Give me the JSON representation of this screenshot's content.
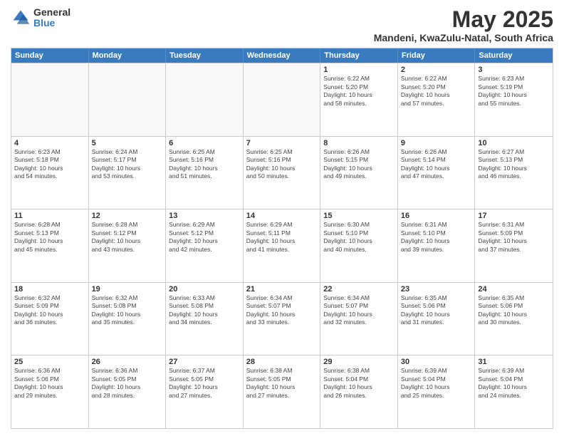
{
  "logo": {
    "general": "General",
    "blue": "Blue"
  },
  "title": {
    "month": "May 2025",
    "location": "Mandeni, KwaZulu-Natal, South Africa"
  },
  "calendar": {
    "headers": [
      "Sunday",
      "Monday",
      "Tuesday",
      "Wednesday",
      "Thursday",
      "Friday",
      "Saturday"
    ],
    "weeks": [
      [
        {
          "day": "",
          "detail": ""
        },
        {
          "day": "",
          "detail": ""
        },
        {
          "day": "",
          "detail": ""
        },
        {
          "day": "",
          "detail": ""
        },
        {
          "day": "1",
          "detail": "Sunrise: 6:22 AM\nSunset: 5:20 PM\nDaylight: 10 hours\nand 58 minutes."
        },
        {
          "day": "2",
          "detail": "Sunrise: 6:22 AM\nSunset: 5:20 PM\nDaylight: 10 hours\nand 57 minutes."
        },
        {
          "day": "3",
          "detail": "Sunrise: 6:23 AM\nSunset: 5:19 PM\nDaylight: 10 hours\nand 55 minutes."
        }
      ],
      [
        {
          "day": "4",
          "detail": "Sunrise: 6:23 AM\nSunset: 5:18 PM\nDaylight: 10 hours\nand 54 minutes."
        },
        {
          "day": "5",
          "detail": "Sunrise: 6:24 AM\nSunset: 5:17 PM\nDaylight: 10 hours\nand 53 minutes."
        },
        {
          "day": "6",
          "detail": "Sunrise: 6:25 AM\nSunset: 5:16 PM\nDaylight: 10 hours\nand 51 minutes."
        },
        {
          "day": "7",
          "detail": "Sunrise: 6:25 AM\nSunset: 5:16 PM\nDaylight: 10 hours\nand 50 minutes."
        },
        {
          "day": "8",
          "detail": "Sunrise: 6:26 AM\nSunset: 5:15 PM\nDaylight: 10 hours\nand 49 minutes."
        },
        {
          "day": "9",
          "detail": "Sunrise: 6:26 AM\nSunset: 5:14 PM\nDaylight: 10 hours\nand 47 minutes."
        },
        {
          "day": "10",
          "detail": "Sunrise: 6:27 AM\nSunset: 5:13 PM\nDaylight: 10 hours\nand 46 minutes."
        }
      ],
      [
        {
          "day": "11",
          "detail": "Sunrise: 6:28 AM\nSunset: 5:13 PM\nDaylight: 10 hours\nand 45 minutes."
        },
        {
          "day": "12",
          "detail": "Sunrise: 6:28 AM\nSunset: 5:12 PM\nDaylight: 10 hours\nand 43 minutes."
        },
        {
          "day": "13",
          "detail": "Sunrise: 6:29 AM\nSunset: 5:12 PM\nDaylight: 10 hours\nand 42 minutes."
        },
        {
          "day": "14",
          "detail": "Sunrise: 6:29 AM\nSunset: 5:11 PM\nDaylight: 10 hours\nand 41 minutes."
        },
        {
          "day": "15",
          "detail": "Sunrise: 6:30 AM\nSunset: 5:10 PM\nDaylight: 10 hours\nand 40 minutes."
        },
        {
          "day": "16",
          "detail": "Sunrise: 6:31 AM\nSunset: 5:10 PM\nDaylight: 10 hours\nand 39 minutes."
        },
        {
          "day": "17",
          "detail": "Sunrise: 6:31 AM\nSunset: 5:09 PM\nDaylight: 10 hours\nand 37 minutes."
        }
      ],
      [
        {
          "day": "18",
          "detail": "Sunrise: 6:32 AM\nSunset: 5:09 PM\nDaylight: 10 hours\nand 36 minutes."
        },
        {
          "day": "19",
          "detail": "Sunrise: 6:32 AM\nSunset: 5:08 PM\nDaylight: 10 hours\nand 35 minutes."
        },
        {
          "day": "20",
          "detail": "Sunrise: 6:33 AM\nSunset: 5:08 PM\nDaylight: 10 hours\nand 34 minutes."
        },
        {
          "day": "21",
          "detail": "Sunrise: 6:34 AM\nSunset: 5:07 PM\nDaylight: 10 hours\nand 33 minutes."
        },
        {
          "day": "22",
          "detail": "Sunrise: 6:34 AM\nSunset: 5:07 PM\nDaylight: 10 hours\nand 32 minutes."
        },
        {
          "day": "23",
          "detail": "Sunrise: 6:35 AM\nSunset: 5:06 PM\nDaylight: 10 hours\nand 31 minutes."
        },
        {
          "day": "24",
          "detail": "Sunrise: 6:35 AM\nSunset: 5:06 PM\nDaylight: 10 hours\nand 30 minutes."
        }
      ],
      [
        {
          "day": "25",
          "detail": "Sunrise: 6:36 AM\nSunset: 5:06 PM\nDaylight: 10 hours\nand 29 minutes."
        },
        {
          "day": "26",
          "detail": "Sunrise: 6:36 AM\nSunset: 5:05 PM\nDaylight: 10 hours\nand 28 minutes."
        },
        {
          "day": "27",
          "detail": "Sunrise: 6:37 AM\nSunset: 5:05 PM\nDaylight: 10 hours\nand 27 minutes."
        },
        {
          "day": "28",
          "detail": "Sunrise: 6:38 AM\nSunset: 5:05 PM\nDaylight: 10 hours\nand 27 minutes."
        },
        {
          "day": "29",
          "detail": "Sunrise: 6:38 AM\nSunset: 5:04 PM\nDaylight: 10 hours\nand 26 minutes."
        },
        {
          "day": "30",
          "detail": "Sunrise: 6:39 AM\nSunset: 5:04 PM\nDaylight: 10 hours\nand 25 minutes."
        },
        {
          "day": "31",
          "detail": "Sunrise: 6:39 AM\nSunset: 5:04 PM\nDaylight: 10 hours\nand 24 minutes."
        }
      ]
    ]
  }
}
